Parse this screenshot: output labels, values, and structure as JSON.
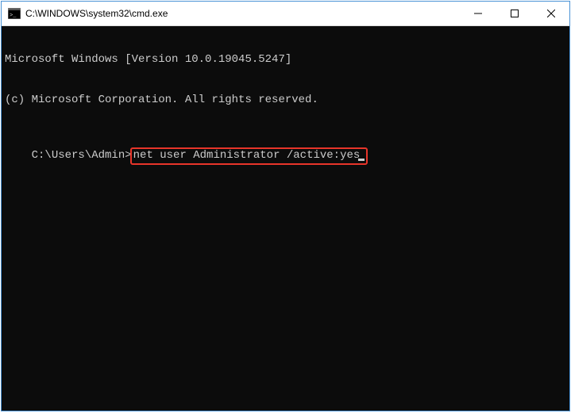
{
  "titlebar": {
    "title": "C:\\WINDOWS\\system32\\cmd.exe"
  },
  "terminal": {
    "line1": "Microsoft Windows [Version 10.0.19045.5247]",
    "line2": "(c) Microsoft Corporation. All rights reserved.",
    "blank1": "",
    "prompt": "C:\\Users\\Admin>",
    "command": "net user Administrator /active:yes"
  }
}
